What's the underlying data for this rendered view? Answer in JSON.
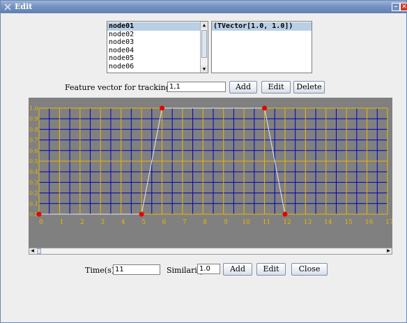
{
  "window": {
    "title": "Edit",
    "minimize_glyph": "–",
    "close_glyph": "✕"
  },
  "node_list": {
    "items": [
      "node01",
      "node02",
      "node03",
      "node04",
      "node05",
      "node06"
    ],
    "selected": "node01"
  },
  "vector_list": {
    "items": [
      "(TVector[1.0, 1.0])"
    ],
    "selected": "(TVector[1.0, 1.0])"
  },
  "feature": {
    "label": "Feature vector for tracking target",
    "value": "1,1",
    "add_label": "Add",
    "edit_label": "Edit",
    "delete_label": "Delete"
  },
  "chart_data": {
    "type": "line",
    "x": [
      0,
      5,
      6,
      11,
      12
    ],
    "y": [
      0.0,
      0.0,
      1.0,
      1.0,
      0.0
    ],
    "xlim": [
      0,
      17
    ],
    "ylim": [
      0,
      1.0
    ],
    "x_ticks": [
      "0",
      "1",
      "2",
      "3",
      "4",
      "5",
      "6",
      "7",
      "8",
      "9",
      "10",
      "11",
      "12",
      "13",
      "14",
      "15",
      "16",
      "17"
    ],
    "y_ticks": [
      "0.0",
      "0.1",
      "0.2",
      "0.3",
      "0.4",
      "0.5",
      "0.6",
      "0.7",
      "0.8",
      "0.9",
      "1.0"
    ],
    "grid": true,
    "colors": {
      "background": "#808080",
      "grid_major": "#e8b800",
      "grid_minor": "#0000b8",
      "line": "#e8e8e8",
      "point": "#e60000",
      "tick_text": "#e8b800"
    }
  },
  "bottom": {
    "time_label": "Time(s)",
    "time_value": "11",
    "similarity_label": "Similarity",
    "similarity_value": "1.0",
    "add_label": "Add",
    "edit_label": "Edit",
    "close_label": "Close"
  }
}
